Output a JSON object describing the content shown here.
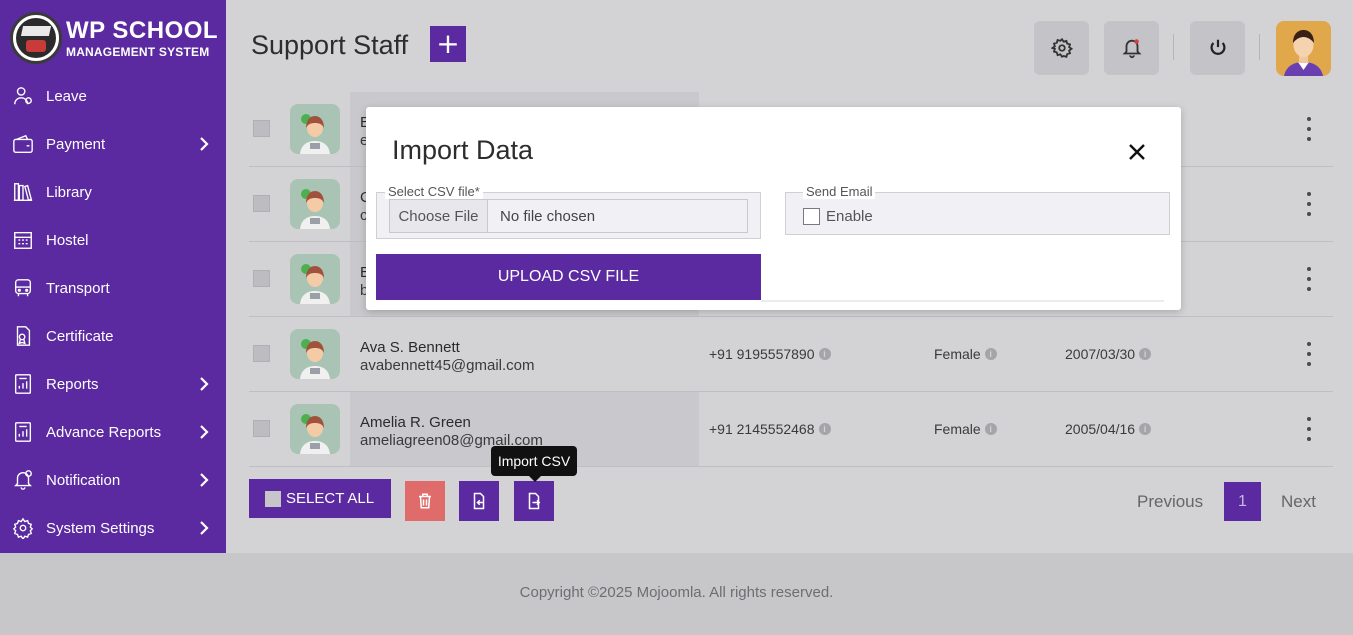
{
  "app": {
    "logo_title": "WP SCHOOL",
    "logo_subtitle": "MANAGEMENT SYSTEM"
  },
  "sidebar": {
    "items": [
      {
        "label": "Leave",
        "icon": "leave-icon",
        "has_submenu": false
      },
      {
        "label": "Payment",
        "icon": "wallet-icon",
        "has_submenu": true
      },
      {
        "label": "Library",
        "icon": "library-icon",
        "has_submenu": false
      },
      {
        "label": "Hostel",
        "icon": "hostel-icon",
        "has_submenu": false
      },
      {
        "label": "Transport",
        "icon": "bus-icon",
        "has_submenu": false
      },
      {
        "label": "Certificate",
        "icon": "certificate-icon",
        "has_submenu": false
      },
      {
        "label": "Reports",
        "icon": "reports-icon",
        "has_submenu": true
      },
      {
        "label": "Advance Reports",
        "icon": "advance-reports-icon",
        "has_submenu": true
      },
      {
        "label": "Notification",
        "icon": "bell-icon",
        "has_submenu": true
      },
      {
        "label": "System Settings",
        "icon": "gear-icon",
        "has_submenu": true
      }
    ]
  },
  "header": {
    "title": "Support Staff",
    "add_label": "+"
  },
  "staff": [
    {
      "name": "E",
      "email": "e",
      "phone": "",
      "gender": "",
      "dob": ""
    },
    {
      "name": "C",
      "email": "c",
      "phone": "",
      "gender": "",
      "dob": ""
    },
    {
      "name": "E",
      "email": "b",
      "phone": "",
      "gender": "",
      "dob": ""
    },
    {
      "name": "Ava S. Bennett",
      "email": "avabennett45@gmail.com",
      "phone": "+91 9195557890",
      "gender": "Female",
      "dob": "2007/03/30"
    },
    {
      "name": "Amelia R. Green",
      "email": "ameliagreen08@gmail.com",
      "phone": "+91 2145552468",
      "gender": "Female",
      "dob": "2005/04/16"
    }
  ],
  "actions": {
    "select_all": "SELECT ALL",
    "tooltip": "Import CSV"
  },
  "pagination": {
    "previous": "Previous",
    "current": "1",
    "next": "Next"
  },
  "footer": {
    "copyright": "Copyright ©2025 Mojoomla. All rights reserved."
  },
  "modal": {
    "title": "Import Data",
    "csv_legend": "Select CSV file*",
    "choose_file": "Choose File",
    "no_file": "No file chosen",
    "email_legend": "Send Email",
    "enable_label": "Enable",
    "upload_label": "UPLOAD CSV FILE"
  },
  "colors": {
    "primary": "#5b2aa0",
    "danger": "#e06b6b",
    "overlay_bg": "#d3d3d6"
  }
}
